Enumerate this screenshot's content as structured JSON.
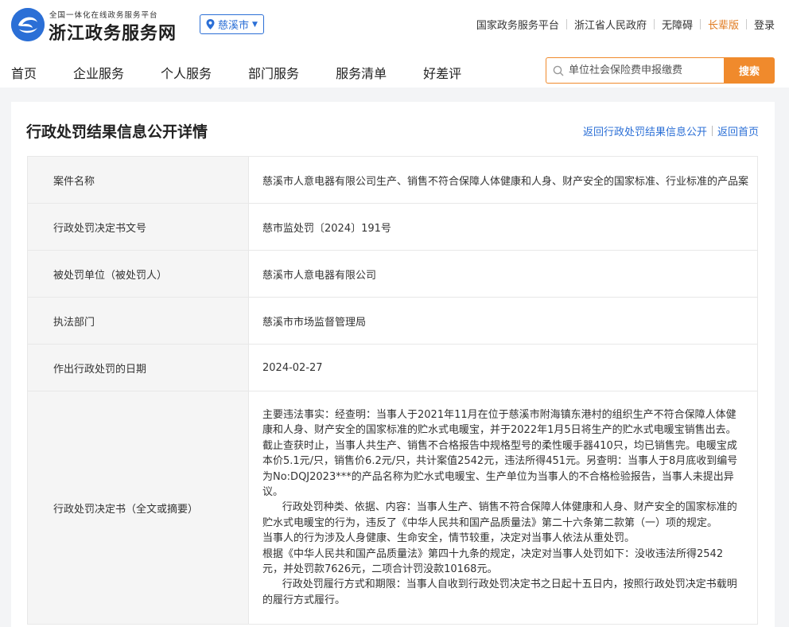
{
  "header": {
    "brand_sub": "全国一体化在线政务服务平台",
    "brand_title": "浙江政务服务网",
    "city": "慈溪市",
    "top_links": [
      "国家政务服务平台",
      "浙江省人民政府",
      "无障碍",
      "长辈版",
      "登录"
    ]
  },
  "nav": {
    "items": [
      "首页",
      "企业服务",
      "个人服务",
      "部门服务",
      "服务清单",
      "好差评"
    ],
    "search_placeholder": "单位社会保险费申报缴费",
    "search_button": "搜索"
  },
  "page": {
    "title": "行政处罚结果信息公开详情",
    "back_links": [
      "返回行政处罚结果信息公开",
      "返回首页"
    ]
  },
  "details": [
    {
      "label": "案件名称",
      "value": "慈溪市人意电器有限公司生产、销售不符合保障人体健康和人身、财产安全的国家标准、行业标准的产品案"
    },
    {
      "label": "行政处罚决定书文号",
      "value": "慈市监处罚〔2024〕191号"
    },
    {
      "label": "被处罚单位（被处罚人）",
      "value": "慈溪市人意电器有限公司"
    },
    {
      "label": "执法部门",
      "value": "慈溪市市场监督管理局"
    },
    {
      "label": "作出行政处罚的日期",
      "value": "2024-02-27"
    },
    {
      "label": "行政处罚决定书（全文或摘要）",
      "paragraphs": [
        "主要违法事实：经查明：当事人于2021年11月在位于慈溪市附海镇东港村的组织生产不符合保障人体健康和人身、财产安全的国家标准的贮水式电暖宝，并于2022年1月5日将生产的贮水式电暖宝销售出去。截止查获时止，当事人共生产、销售不合格报告中规格型号的柔性暖手器410只，均已销售完。电暖宝成本价5.1元/只，销售价6.2元/只，共计案值2542元，违法所得451元。另查明：当事人于8月底收到编号为No:DQJ2023***的产品名称为贮水式电暖宝、生产单位为当事人的不合格检验报告，当事人未提出异议。",
        "      行政处罚种类、依据、内容：当事人生产、销售不符合保障人体健康和人身、财产安全的国家标准的贮水式电暖宝的行为，违反了《中华人民共和国产品质量法》第二十六条第二款第（一）项的规定。                    当事人的行为涉及人身健康、生命安全，情节较重，决定对当事人依法从重处罚。                                              根据《中华人民共和国产品质量法》第四十九条的规定，决定对当事人处罚如下：没收违法所得2542元，并处罚款7626元，二项合计罚没款10168元。",
        "      行政处罚履行方式和期限：当事人自收到行政处罚决定书之日起十五日内，按照行政处罚决定书载明的履行方式履行。"
      ]
    }
  ],
  "colors": {
    "accent": "#2b6fd6",
    "orange": "#f08a2c",
    "label_bg": "#f5f5f5",
    "page_bg": "#f3f4f6"
  }
}
